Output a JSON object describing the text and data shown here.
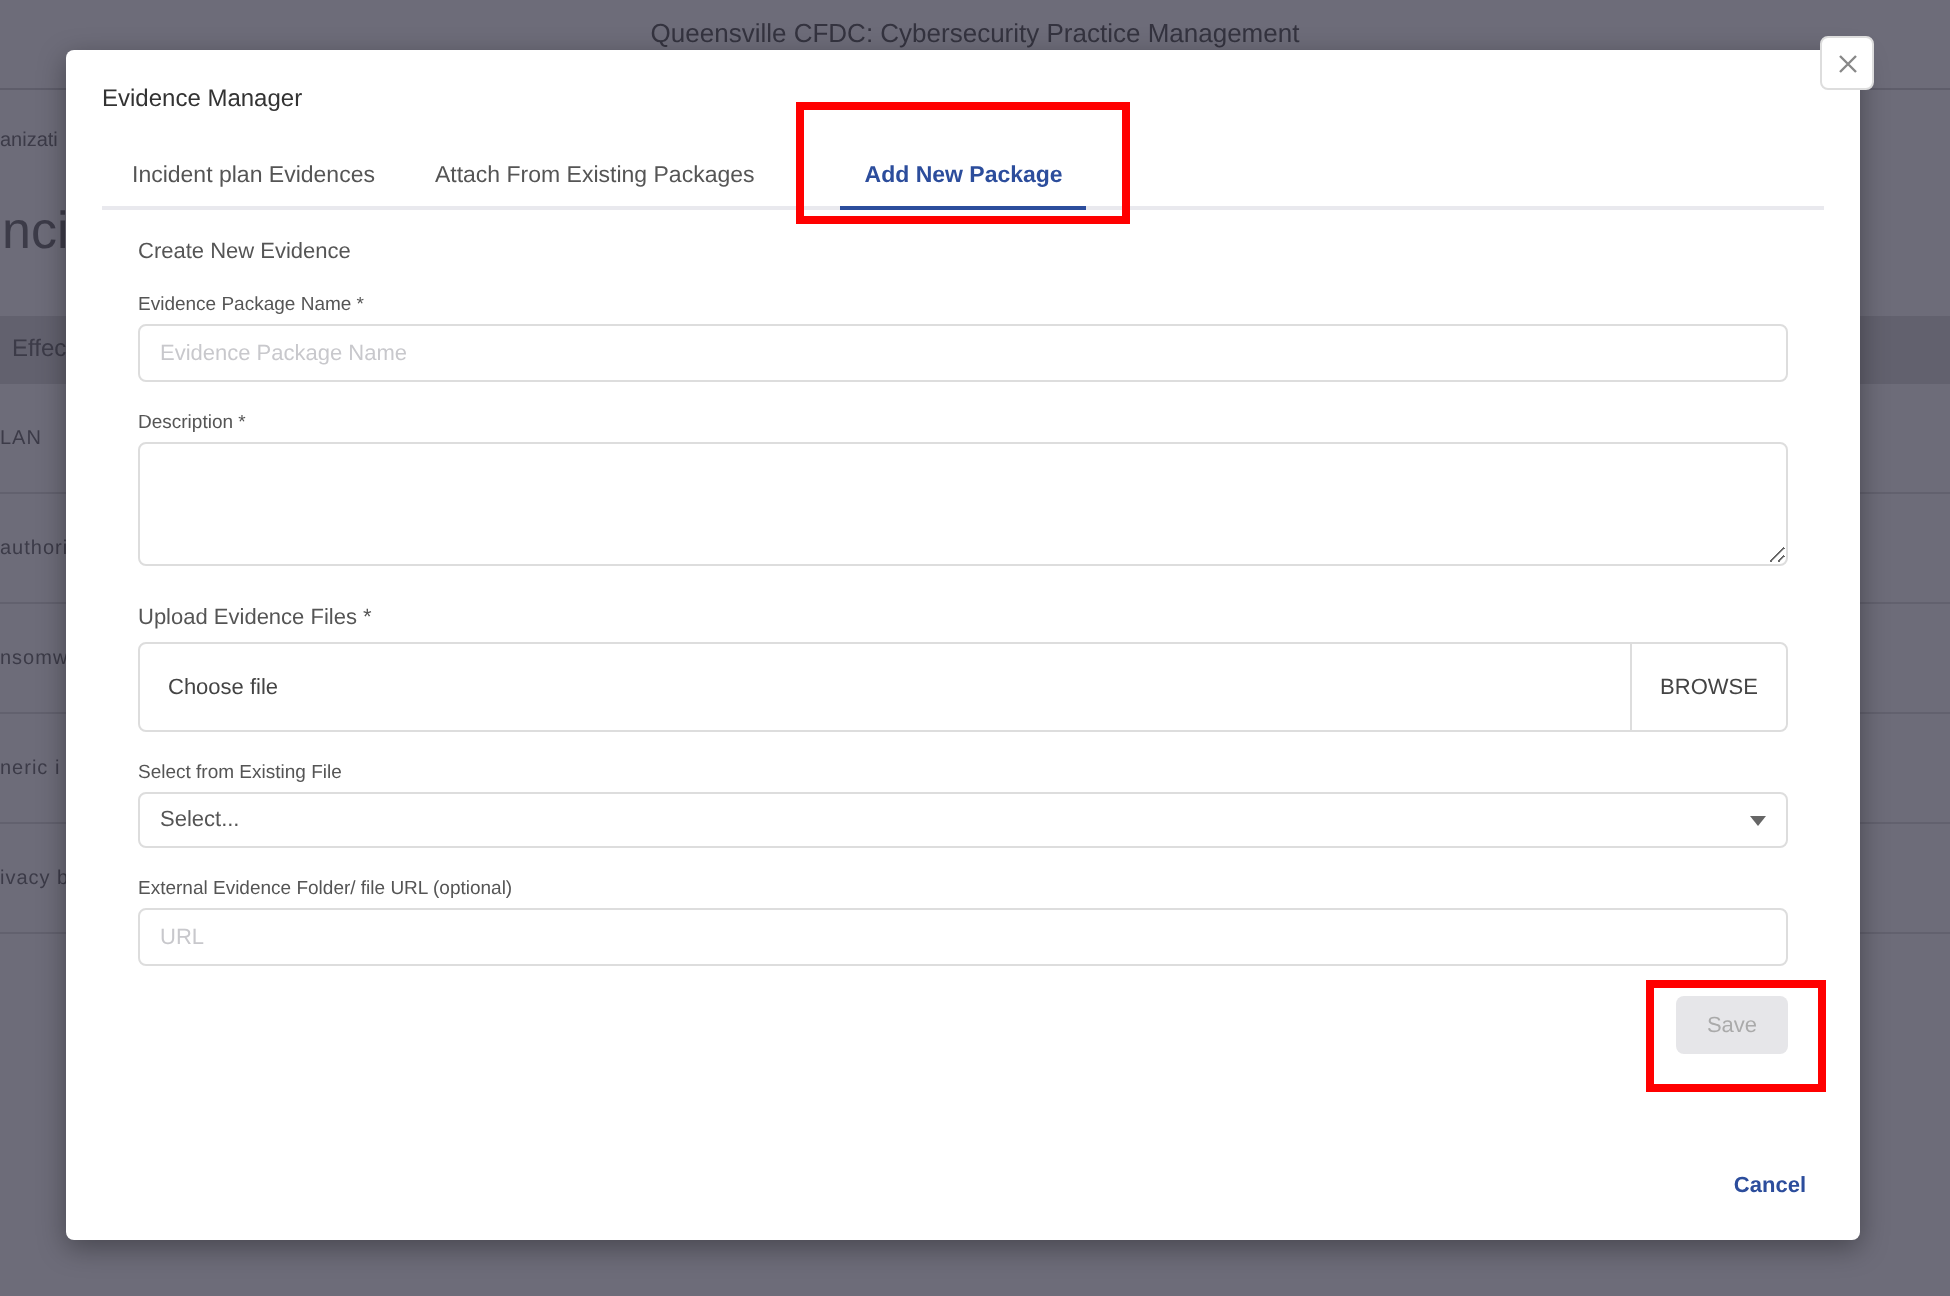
{
  "background": {
    "header_title": "Queensville CFDC: Cybersecurity Practice Management",
    "breadcrumb": "anizati",
    "heading": "nci",
    "table_header": "Effec",
    "rows": [
      "LAN",
      "authori",
      "nsomw",
      "neric i",
      "ivacy b"
    ]
  },
  "dialog": {
    "title": "Evidence Manager",
    "tabs": [
      {
        "label": "Incident plan Evidences",
        "selected": false,
        "highlighted": false
      },
      {
        "label": "Attach From Existing Packages",
        "selected": false,
        "highlighted": false
      },
      {
        "label": "Add New Package",
        "selected": true,
        "highlighted": true
      }
    ],
    "section_title": "Create New Evidence",
    "fields": [
      {
        "kind": "text",
        "label": "Evidence Package Name *",
        "placeholder": "Evidence Package Name"
      },
      {
        "kind": "textarea",
        "label": "Description *"
      },
      {
        "kind": "file",
        "label": "Upload Evidence Files *",
        "value": "Choose file",
        "button": "BROWSE"
      },
      {
        "kind": "select",
        "label": "Select from Existing File",
        "value": "Select..."
      },
      {
        "kind": "text",
        "label": "External Evidence Folder/ file URL (optional)",
        "placeholder": "URL"
      }
    ],
    "save": {
      "label": "Save",
      "disabled": true,
      "highlighted": true
    },
    "cancel": "Cancel"
  }
}
